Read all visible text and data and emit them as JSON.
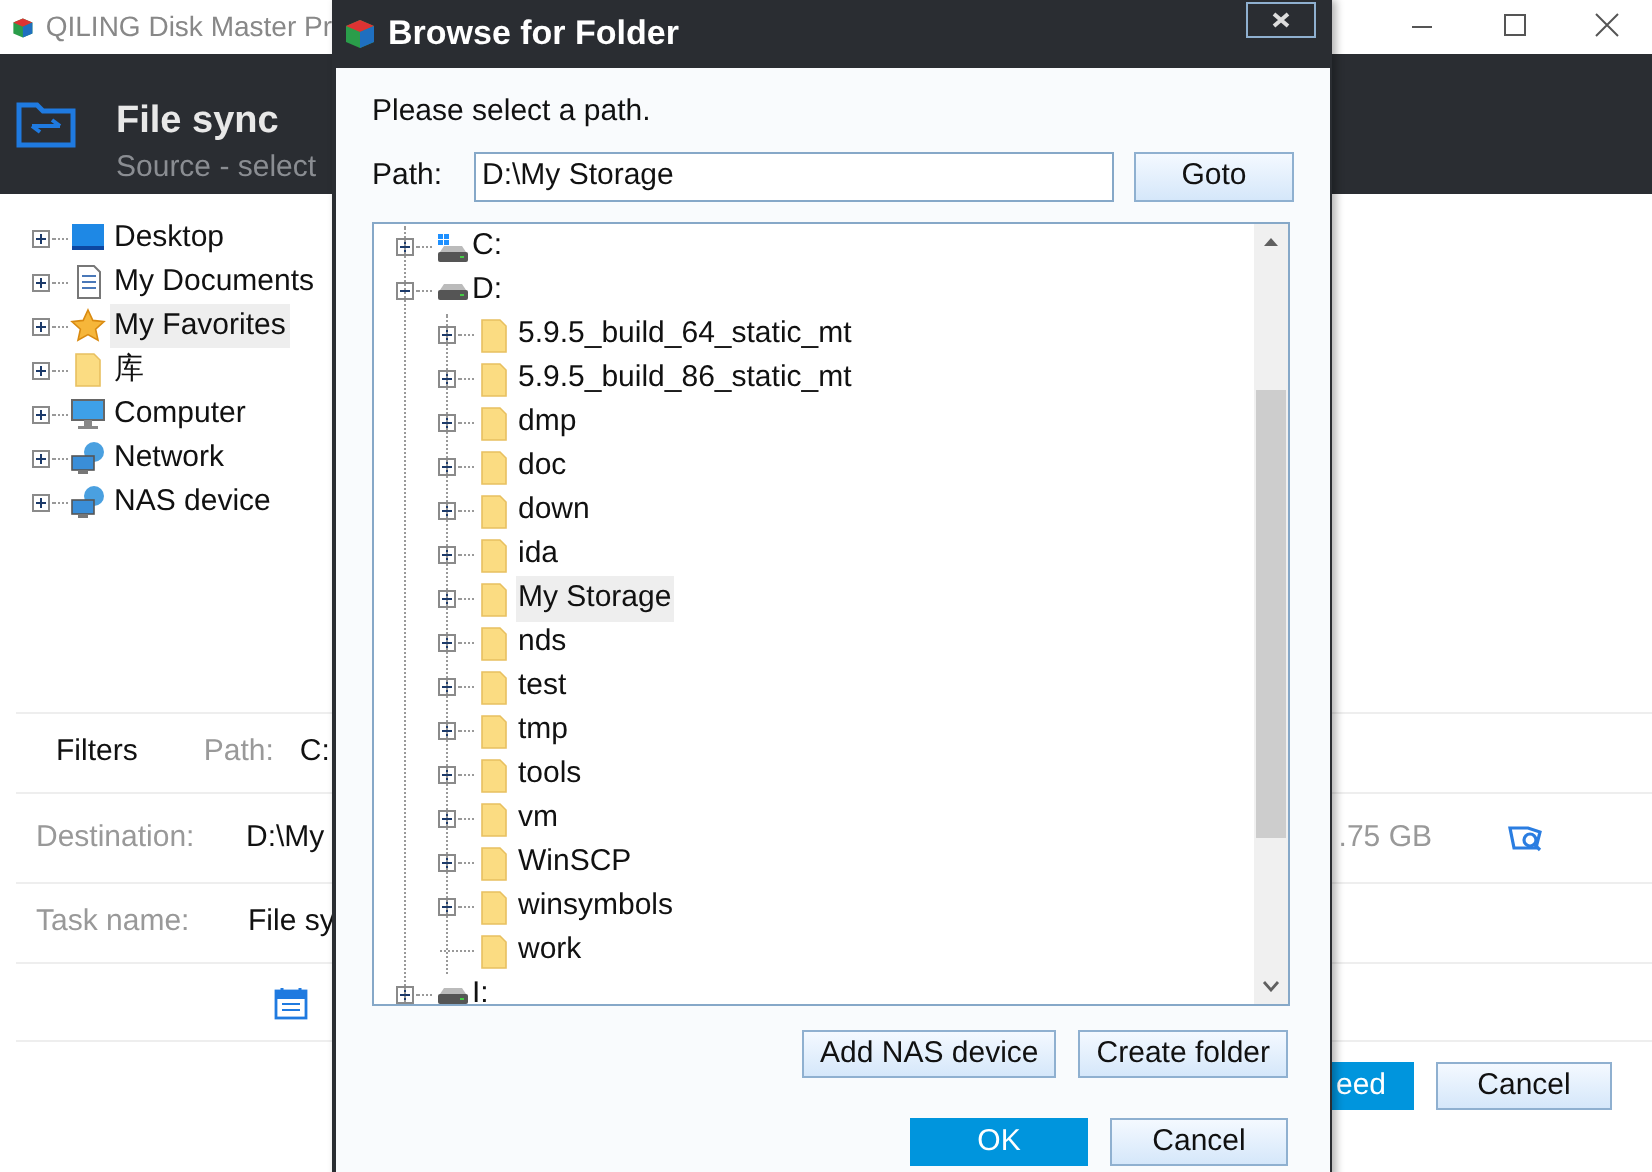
{
  "app": {
    "title": "QILING Disk Master Pr",
    "header": {
      "title": "File sync",
      "subtitle": "Source - select"
    },
    "left_tree": [
      {
        "label": "Desktop",
        "kind": "desktop",
        "selected": false
      },
      {
        "label": "My Documents",
        "kind": "documents",
        "selected": false
      },
      {
        "label": "My Favorites",
        "kind": "star",
        "selected": true
      },
      {
        "label": "库",
        "kind": "folder",
        "selected": false
      },
      {
        "label": "Computer",
        "kind": "computer",
        "selected": false
      },
      {
        "label": "Network",
        "kind": "network",
        "selected": false
      },
      {
        "label": "NAS device",
        "kind": "network",
        "selected": false
      }
    ],
    "filters": {
      "label": "Filters",
      "path_label": "Path:",
      "path_value": "C:"
    },
    "destination": {
      "label": "Destination:",
      "value": "D:\\My",
      "size": ".75 GB"
    },
    "task_name": {
      "label": "Task name:",
      "value": "File sy"
    },
    "buttons": [
      {
        "label": "eed",
        "kind": "primary"
      },
      {
        "label": "Cancel",
        "kind": "secondary"
      }
    ]
  },
  "dialog": {
    "title": "Browse for Folder",
    "prompt": "Please select a path.",
    "path_label": "Path:",
    "path_value": "D:\\My Storage",
    "goto": "Goto",
    "tree": [
      {
        "label": "C:",
        "kind": "system_drive",
        "expanded": false,
        "selected": false
      },
      {
        "label": "D:",
        "kind": "drive",
        "expanded": true,
        "selected": false,
        "children": [
          {
            "label": "5.9.5_build_64_static_mt",
            "kind": "folder",
            "expanded": false,
            "selected": false
          },
          {
            "label": "5.9.5_build_86_static_mt",
            "kind": "folder",
            "expanded": false,
            "selected": false
          },
          {
            "label": "dmp",
            "kind": "folder",
            "expanded": false,
            "selected": false
          },
          {
            "label": "doc",
            "kind": "folder",
            "expanded": false,
            "selected": false
          },
          {
            "label": "down",
            "kind": "folder",
            "expanded": false,
            "selected": false
          },
          {
            "label": "ida",
            "kind": "folder",
            "expanded": false,
            "selected": false
          },
          {
            "label": "My Storage",
            "kind": "folder",
            "expanded": false,
            "selected": true
          },
          {
            "label": "nds",
            "kind": "folder",
            "expanded": false,
            "selected": false
          },
          {
            "label": "test",
            "kind": "folder",
            "expanded": false,
            "selected": false
          },
          {
            "label": "tmp",
            "kind": "folder",
            "expanded": false,
            "selected": false
          },
          {
            "label": "tools",
            "kind": "folder",
            "expanded": false,
            "selected": false
          },
          {
            "label": "vm",
            "kind": "folder",
            "expanded": false,
            "selected": false
          },
          {
            "label": "WinSCP",
            "kind": "folder",
            "expanded": false,
            "selected": false
          },
          {
            "label": "winsymbols",
            "kind": "folder",
            "expanded": false,
            "selected": false
          },
          {
            "label": "work",
            "kind": "folder",
            "selected": false
          }
        ]
      },
      {
        "label": "I:",
        "kind": "drive",
        "expanded": false,
        "selected": false
      }
    ],
    "action_buttons": [
      {
        "label": "Add NAS device"
      },
      {
        "label": "Create folder"
      }
    ],
    "buttons": [
      {
        "label": "OK",
        "kind": "primary"
      },
      {
        "label": "Cancel",
        "kind": "secondary"
      }
    ]
  }
}
